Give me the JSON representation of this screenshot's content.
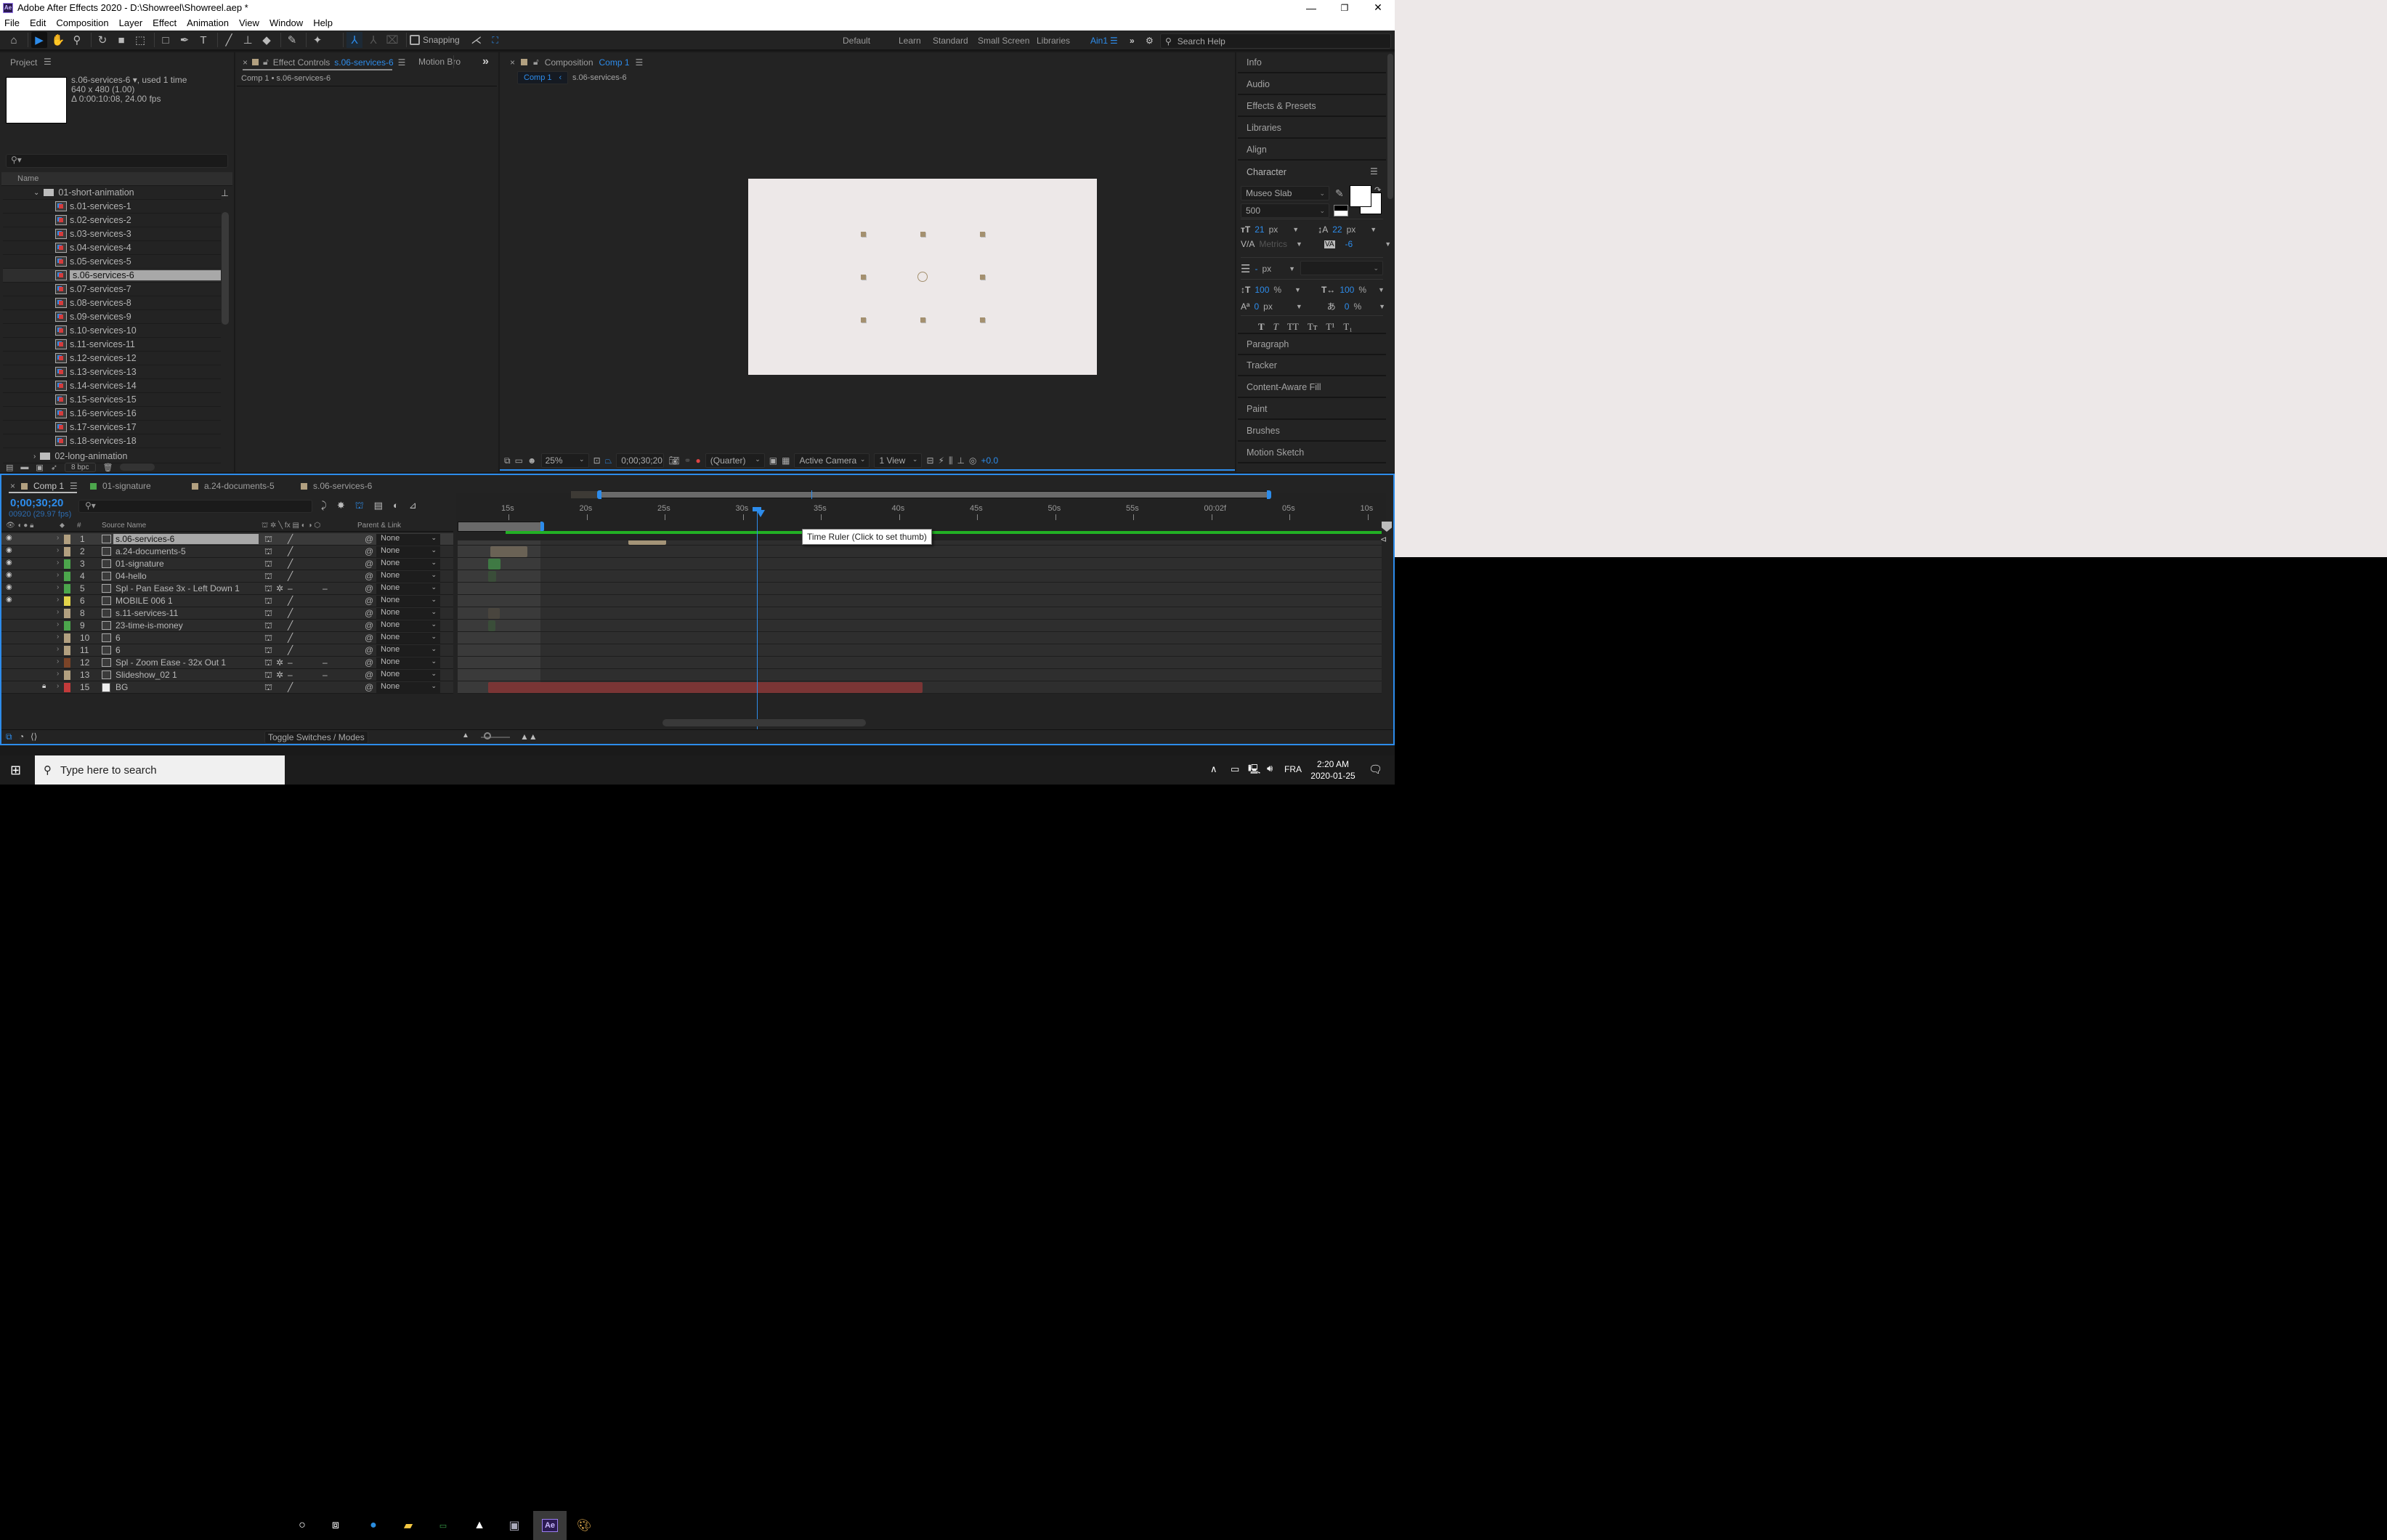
{
  "window": {
    "title": "Adobe After Effects 2020 - D:\\Showreel\\Showreel.aep *",
    "app_badge": "Ae",
    "controls": {
      "minimize": "—",
      "maximize": "❐",
      "close": "✕"
    }
  },
  "menu": [
    "File",
    "Edit",
    "Composition",
    "Layer",
    "Effect",
    "Animation",
    "View",
    "Window",
    "Help"
  ],
  "toolbar": {
    "tools": [
      {
        "name": "home-icon",
        "glyph": "⌂"
      },
      {
        "name": "selection-tool-icon",
        "glyph": "▶",
        "active": true
      },
      {
        "name": "hand-tool-icon",
        "glyph": "✋"
      },
      {
        "name": "zoom-tool-icon",
        "glyph": "⚲"
      },
      {
        "name": "rotation-tool-icon",
        "glyph": "↻"
      },
      {
        "name": "camera-tool-icon",
        "glyph": "■"
      },
      {
        "name": "pan-behind-tool-icon",
        "glyph": "⬚"
      },
      {
        "name": "rectangle-tool-icon",
        "glyph": "□"
      },
      {
        "name": "pen-tool-icon",
        "glyph": "✒"
      },
      {
        "name": "type-tool-icon",
        "glyph": "T"
      },
      {
        "name": "brush-tool-icon",
        "glyph": "╱"
      },
      {
        "name": "clone-stamp-tool-icon",
        "glyph": "⊥"
      },
      {
        "name": "eraser-tool-icon",
        "glyph": "◆"
      },
      {
        "name": "roto-brush-tool-icon",
        "glyph": "✎"
      },
      {
        "name": "puppet-pin-tool-icon",
        "glyph": "✦"
      }
    ],
    "snapping_label": "Snapping"
  },
  "workspaces": {
    "items": [
      "Default",
      "Learn",
      "Standard",
      "Small Screen",
      "Libraries"
    ],
    "active": "Ain1",
    "search_placeholder": "Search Help"
  },
  "project": {
    "title": "Project",
    "selected_name": "s.06-services-6",
    "used": ", used 1 time",
    "dimensions": "640 x 480 (1.00)",
    "duration": "Δ 0:00:10:08, 24.00 fps",
    "column_name": "Name",
    "folder_open": "01-short-animation",
    "items": [
      "s.01-services-1",
      "s.02-services-2",
      "s.03-services-3",
      "s.04-services-4",
      "s.05-services-5",
      "s.06-services-6",
      "s.07-services-7",
      "s.08-services-8",
      "s.09-services-9",
      "s.10-services-10",
      "s.11-services-11",
      "s.12-services-12",
      "s.13-services-13",
      "s.14-services-14",
      "s.15-services-15",
      "s.16-services-16",
      "s.17-services-17",
      "s.18-services-18"
    ],
    "selected_index": 5,
    "folder_closed": "02-long-animation",
    "bpc": "8 bpc"
  },
  "effect_controls": {
    "tab_prefix": "Effect Controls",
    "tab_target": "s.06-services-6",
    "other_tab": "Motion Bro",
    "breadcrumb": "Comp 1 • s.06-services-6"
  },
  "composition": {
    "tab_prefix": "Composition",
    "tab_target": "Comp 1",
    "crumb_active": "Comp 1",
    "crumb_next": "s.06-services-6",
    "zoom": "25%",
    "timecode": "0;00;30;20",
    "resolution": "(Quarter)",
    "camera": "Active Camera",
    "views": "1 View",
    "exposure": "+0.0",
    "canvas_bg": "#ede8e8",
    "handle_color": "#a4906f"
  },
  "right_panels": {
    "top": [
      "Info",
      "Audio",
      "Effects & Presets",
      "Libraries",
      "Align"
    ],
    "character": {
      "title": "Character",
      "font": "Museo Slab",
      "weight": "500",
      "size": "21",
      "size_unit": "px",
      "leading": "22",
      "leading_unit": "px",
      "kerning": "Metrics",
      "tracking": "-6",
      "stroke": "-",
      "stroke_unit": "px",
      "vscale": "100",
      "hscale": "100",
      "pct": "%",
      "baseline": "0",
      "baseline_unit": "px",
      "tsume": "0",
      "styles": [
        "T",
        "T",
        "TT",
        "Tт",
        "T¹",
        "T₁"
      ]
    },
    "bottom": [
      "Paragraph",
      "Tracker",
      "Content-Aware Fill",
      "Paint",
      "Brushes",
      "Motion Sketch"
    ]
  },
  "timeline": {
    "tabs": [
      {
        "label": "Comp 1",
        "color": "#b2a080",
        "active": true
      },
      {
        "label": "01-signature",
        "color": "#4ca64c"
      },
      {
        "label": "a.24-documents-5",
        "color": "#b2a080"
      },
      {
        "label": "s.06-services-6",
        "color": "#b2a080"
      }
    ],
    "current_time": "0;00;30;20",
    "frame_info": "00920 (29.97 fps)",
    "columns": {
      "source_name": "Source Name",
      "parent": "Parent & Link",
      "hash": "#"
    },
    "layers": [
      {
        "num": "1",
        "name": "s.06-services-6",
        "color": "#b2a080",
        "eye": true,
        "selected": true,
        "fx": false,
        "parent": "None"
      },
      {
        "num": "2",
        "name": "a.24-documents-5",
        "color": "#b2a080",
        "eye": true,
        "parent": "None"
      },
      {
        "num": "3",
        "name": "01-signature",
        "color": "#4ca64c",
        "eye": true,
        "parent": "None"
      },
      {
        "num": "4",
        "name": "04-hello",
        "color": "#4ca64c",
        "eye": true,
        "parent": "None"
      },
      {
        "num": "5",
        "name": "Spl - Pan Ease 3x - Left Down 1",
        "color": "#4ca64c",
        "eye": true,
        "adj": true,
        "parent": "None"
      },
      {
        "num": "6",
        "name": "MOBILE 006 1",
        "color": "#e3d44a",
        "eye": true,
        "parent": "None"
      },
      {
        "num": "8",
        "name": "s.11-services-11",
        "color": "#b2a080",
        "eye": false,
        "parent": "None"
      },
      {
        "num": "9",
        "name": "23-time-is-money",
        "color": "#4ca64c",
        "eye": false,
        "parent": "None"
      },
      {
        "num": "10",
        "name": "6",
        "color": "#b2a080",
        "eye": false,
        "parent": "None"
      },
      {
        "num": "11",
        "name": "6",
        "color": "#b2a080",
        "eye": false,
        "parent": "None"
      },
      {
        "num": "12",
        "name": "Spl - Zoom Ease - 32x Out 1",
        "color": "#7b4428",
        "eye": false,
        "adj": true,
        "parent": "None"
      },
      {
        "num": "13",
        "name": "Slideshow_02 1",
        "color": "#b2a080",
        "eye": false,
        "adj": true,
        "parent": "None"
      },
      {
        "num": "15",
        "name": "BG",
        "color": "#c23a3a",
        "eye": false,
        "locked": true,
        "solid": true,
        "parent": "None"
      }
    ],
    "ruler": [
      "15s",
      "20s",
      "25s",
      "30s",
      "35s",
      "40s",
      "45s",
      "50s",
      "55s",
      "00:02f",
      "05s",
      "10s"
    ],
    "tooltip": "Time Ruler (Click to set thumb)",
    "toggle_label": "Toggle Switches / Modes"
  },
  "taskbar": {
    "search_placeholder": "Type here to search",
    "language": "FRA",
    "time": "2:20 AM",
    "date": "2020-01-25"
  }
}
